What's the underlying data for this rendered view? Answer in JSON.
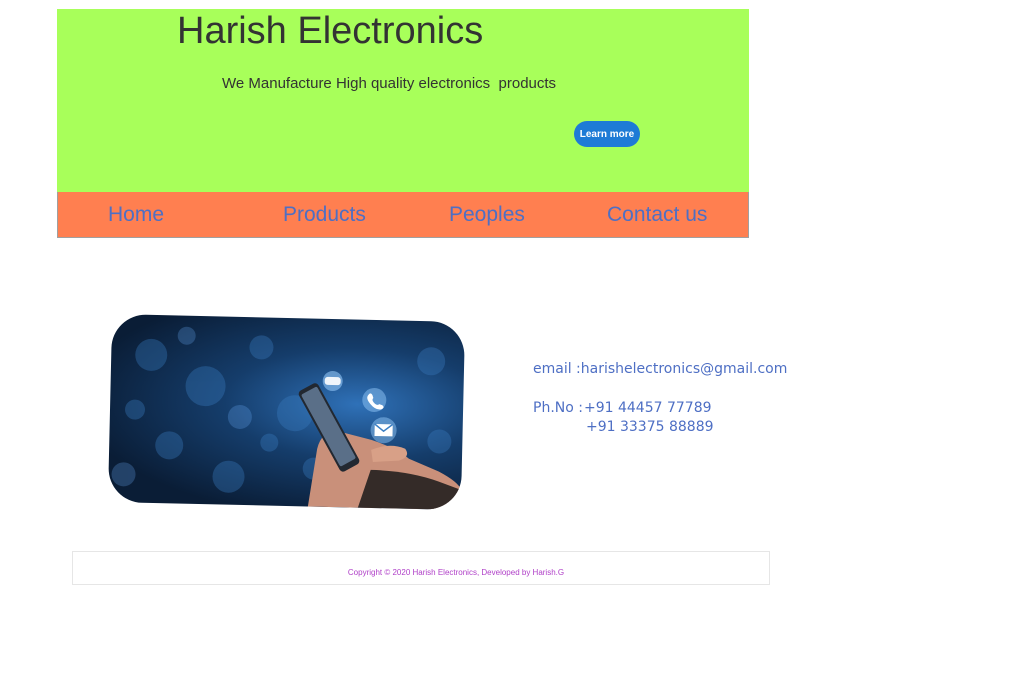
{
  "hero": {
    "title": "Harish Electronics",
    "tagline": "We Manufacture High quality electronics  products",
    "cta_label": "Learn more"
  },
  "nav": {
    "items": [
      {
        "label": "Home"
      },
      {
        "label": "Products"
      },
      {
        "label": "Peoples"
      },
      {
        "label": "Contact us"
      }
    ]
  },
  "contact": {
    "email": "email :harishelectronics@gmail.com",
    "phone_label": "Ph.No :",
    "phones": [
      "+91 44457 77789",
      "+91 33375 88889"
    ]
  },
  "footer": {
    "copyright": "Copyright © 2020 Harish Electronics, Developed by Harish.G"
  },
  "colors": {
    "hero_bg": "#a8ff5a",
    "nav_bg": "#ff7f50",
    "link": "#4e6fc4",
    "button": "#1e7bd6",
    "footer_text": "#b040c8"
  },
  "icons": [
    "chat-bubble-icon",
    "phone-call-icon",
    "email-icon"
  ]
}
